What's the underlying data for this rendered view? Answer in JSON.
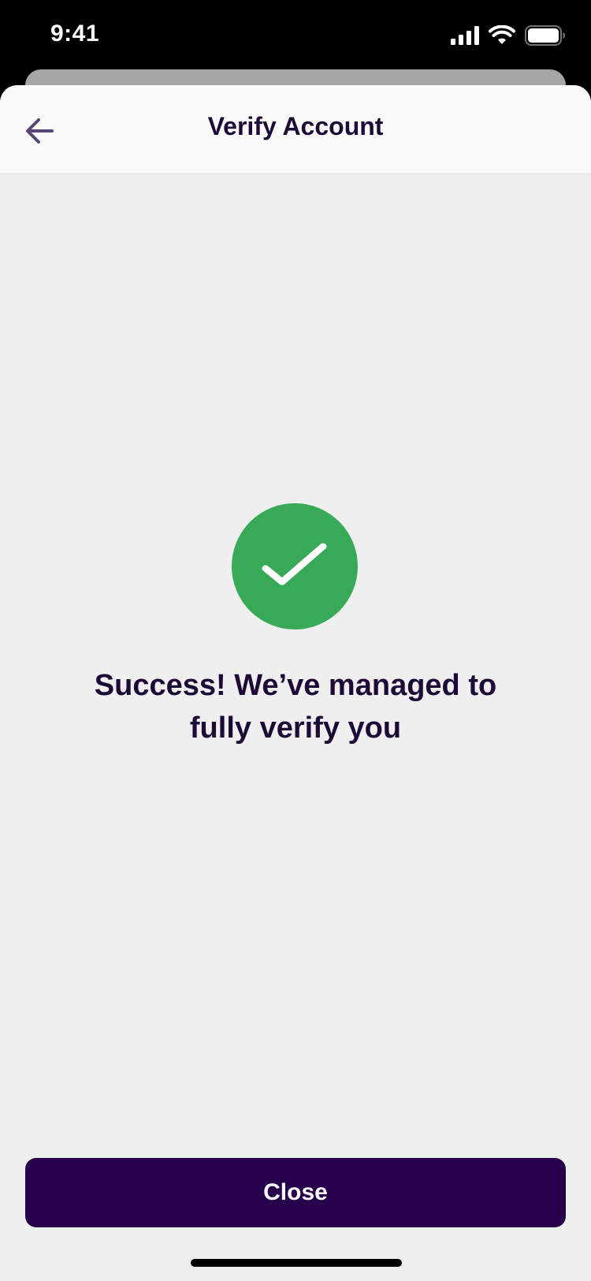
{
  "status_bar": {
    "time": "9:41",
    "icons": [
      "signal-icon",
      "wifi-icon",
      "battery-icon"
    ]
  },
  "nav": {
    "title": "Verify Account",
    "back_icon": "arrow-left-icon"
  },
  "success": {
    "icon": "check-circle-icon",
    "message": "Success! We’ve managed to fully verify you"
  },
  "actions": {
    "close_label": "Close"
  },
  "colors": {
    "accent": "#26004a",
    "success": "#37a957",
    "text": "#1d0a36",
    "background": "#efeff0",
    "nav_background": "#fafafa"
  }
}
